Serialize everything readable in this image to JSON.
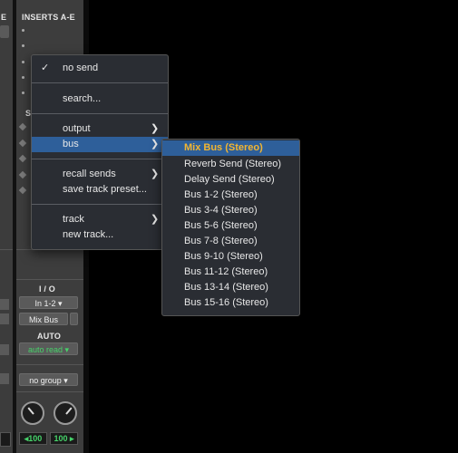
{
  "strip": {
    "inserts_label": "INSERTS A-E",
    "sends_label_partial": "S",
    "left_label_partial": "E",
    "io_label": "I / O",
    "input_select": "In 1-2",
    "output_select": "Mix Bus",
    "auto_label": "AUTO",
    "auto_select": "auto read",
    "group_select": "no group",
    "pan_left_value": "◂100",
    "pan_right_value": "100 ▸"
  },
  "menu": {
    "items": [
      {
        "label": "no send",
        "checked": true,
        "check_glyph": "✓"
      },
      {
        "label": "search..."
      },
      {
        "label": "output",
        "submenu": true
      },
      {
        "label": "bus",
        "submenu": true,
        "highlighted": true
      },
      {
        "label": "recall sends",
        "submenu": true
      },
      {
        "label": "save track preset..."
      },
      {
        "label": "track",
        "submenu": true
      },
      {
        "label": "new track..."
      }
    ],
    "arrow_glyph": "❯"
  },
  "submenu": {
    "items": [
      {
        "label": "Mix Bus (Stereo)",
        "highlighted": true
      },
      {
        "label": "Reverb Send (Stereo)"
      },
      {
        "label": "Delay Send (Stereo)"
      },
      {
        "label": "Bus 1-2 (Stereo)"
      },
      {
        "label": "Bus 3-4 (Stereo)"
      },
      {
        "label": "Bus 5-6 (Stereo)"
      },
      {
        "label": "Bus 7-8 (Stereo)"
      },
      {
        "label": "Bus 9-10 (Stereo)"
      },
      {
        "label": "Bus 11-12 (Stereo)"
      },
      {
        "label": "Bus 13-14 (Stereo)"
      },
      {
        "label": "Bus 15-16 (Stereo)"
      }
    ]
  },
  "colors": {
    "highlight": "#2e5f9a",
    "highlight_text": "#f2b531",
    "menu_bg": "#2a2d33",
    "green_text": "#46d36a"
  }
}
